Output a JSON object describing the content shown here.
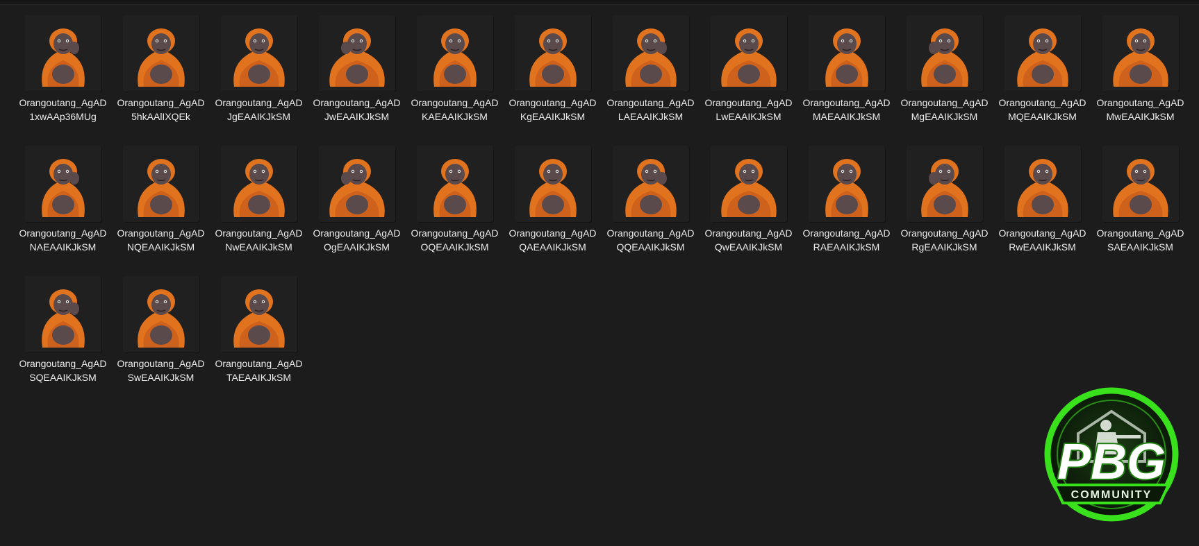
{
  "colors": {
    "background": "#1c1c1c",
    "fur": "#e2731e",
    "fur_dark": "#b9521a",
    "skin": "#5b4a4c",
    "logo_green": "#39e01c"
  },
  "files": [
    {
      "label": "Orangoutang_AgAD1xwAAp36MUg",
      "icon": "orangutan-covering-face-icon"
    },
    {
      "label": "Orangoutang_AgAD5hkAAlIXQEk",
      "icon": "orangutan-at-desk-icon"
    },
    {
      "label": "Orangoutang_AgADJgEAAIKJkSM",
      "icon": "orangutan-waving-icon"
    },
    {
      "label": "Orangoutang_AgADJwEAAIKJkSM",
      "icon": "orangutan-arms-crossed-icon"
    },
    {
      "label": "Orangoutang_AgADKAEAAIKJkSM",
      "icon": "orangutan-thinking-icon"
    },
    {
      "label": "Orangoutang_AgADKgEAAIKJkSM",
      "icon": "orangutan-with-glass-icon"
    },
    {
      "label": "Orangoutang_AgADLAEAAIKJkSM",
      "icon": "orangutan-sitting-icon"
    },
    {
      "label": "Orangoutang_AgADLwEAAIKJkSM",
      "icon": "orangutan-hanging-icon"
    },
    {
      "label": "Orangoutang_AgADMAEAAIKJkSM",
      "icon": "orangutan-facepalm-icon"
    },
    {
      "label": "Orangoutang_AgADMgEAAIKJkSM",
      "icon": "orangutan-eating-icon"
    },
    {
      "label": "Orangoutang_AgADMQEAAIKJkSM",
      "icon": "orangutan-hugging-icon"
    },
    {
      "label": "Orangoutang_AgADMwEAAIKJkSM",
      "icon": "orangutan-hand-on-head-icon"
    },
    {
      "label": "Orangoutang_AgADNAEAAIKJkSM",
      "icon": "orangutan-lying-icon"
    },
    {
      "label": "Orangoutang_AgADNQEAAIKJkSM",
      "icon": "orangutan-resting-chin-icon"
    },
    {
      "label": "Orangoutang_AgADNwEAAIKJkSM",
      "icon": "orangutan-stretching-icon"
    },
    {
      "label": "Orangoutang_AgADOgEAAIKJkSM",
      "icon": "orangutan-with-pillow-icon"
    },
    {
      "label": "Orangoutang_AgADOQEAAIKJkSM",
      "icon": "orangutan-pondering-icon"
    },
    {
      "label": "Orangoutang_AgADQAEAAIKJkSM",
      "icon": "orangutan-praying-icon"
    },
    {
      "label": "Orangoutang_AgADQQEAAIKJkSM",
      "icon": "orangutan-saluting-icon"
    },
    {
      "label": "Orangoutang_AgADQwEAAIKJkSM",
      "icon": "orangutan-bald-icon"
    },
    {
      "label": "Orangoutang_AgADRAEAAIKJkSM",
      "icon": "orangutan-sleeping-icon"
    },
    {
      "label": "Orangoutang_AgADRgEAAIKJkSM",
      "icon": "orangutan-blowing-kiss-icon"
    },
    {
      "label": "Orangoutang_AgADRwEAAIKJkSM",
      "icon": "orangutan-shocked-icon"
    },
    {
      "label": "Orangoutang_AgADSAEAAIKJkSM",
      "icon": "orangutan-smiling-icon"
    },
    {
      "label": "Orangoutang_AgADSQEAAIKJkSM",
      "icon": "orangutan-with-wine-icon"
    },
    {
      "label": "Orangoutang_AgADSwEAAIKJkSM",
      "icon": "orangutan-looking-side-icon"
    },
    {
      "label": "Orangoutang_AgADTAEAAIKJkSM",
      "icon": "orangutan-surprised-icon"
    }
  ],
  "logo": {
    "main_text": "PBG",
    "sub_text": "COMMUNITY",
    "icon": "soldier-emblem-icon"
  }
}
